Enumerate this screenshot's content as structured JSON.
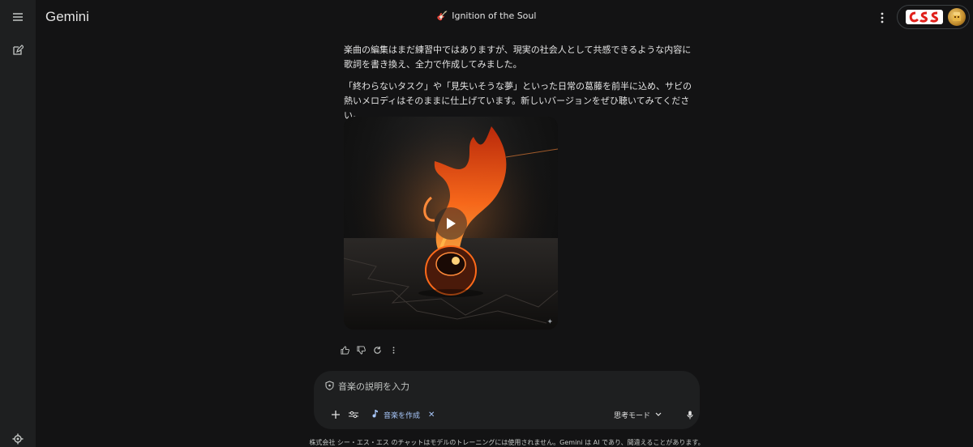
{
  "brand": {
    "name": "Gemini"
  },
  "conversation": {
    "title": "Ignition of the Soul",
    "title_icon": "guitar-icon"
  },
  "account": {
    "org_logo_text": "CSS",
    "avatar_icon": "avatar-icon"
  },
  "message": {
    "paragraph_1": "楽曲の編集はまだ練習中ではありますが、現実の社会人として共感できるような内容に歌詞を書き換え、全力で作成してみました。",
    "paragraph_2": "「終わらないタスク」や「見失いそうな夢」といった日常の葛藤を前半に込め、サビの熱いメロディはそのままに仕上げています。新しいバージョンをぜひ聴いてみてください。",
    "media": {
      "play_icon": "play-icon",
      "sparkle": "✦",
      "colors": {
        "flame": "#ff6a1a",
        "flame_core": "#ffb347"
      }
    }
  },
  "composer": {
    "placeholder": "音楽の説明を入力",
    "chip_label": "音楽を作成",
    "chip_close": "✕",
    "mode_label": "思考モード"
  },
  "disclaimer": "株式会社 シー・エス・エス のチャットはモデルのトレーニングには使用されません。Gemini は AI であり、間違えることがあります。",
  "colors": {
    "background": "#131314",
    "surface": "#1e1f20",
    "accent": "#a8c7fa",
    "text": "#e3e3e3"
  }
}
